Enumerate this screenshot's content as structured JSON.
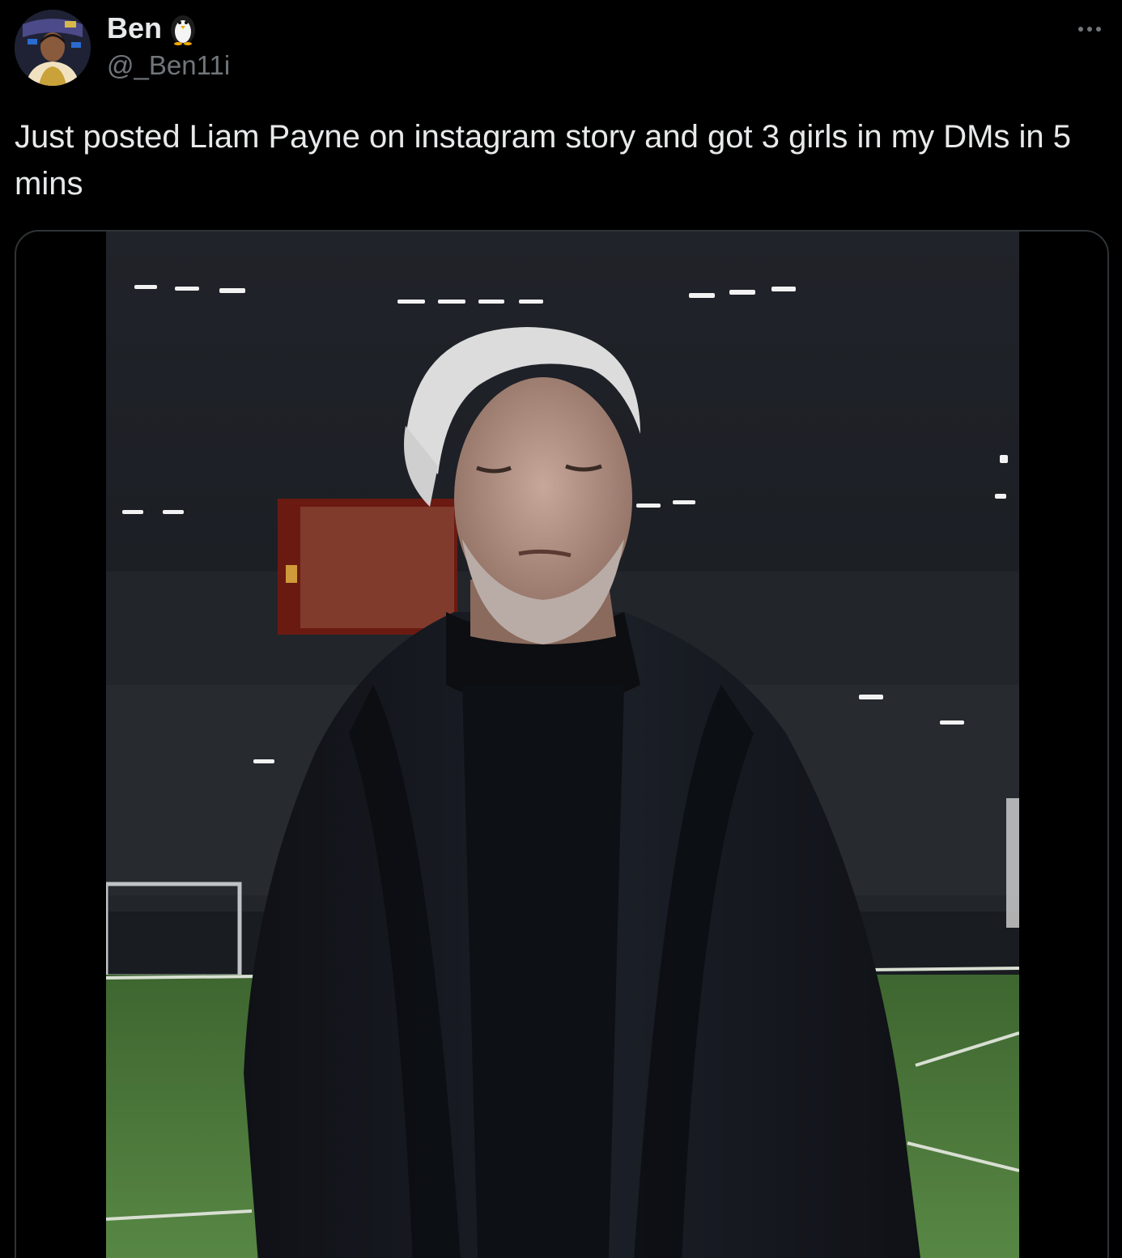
{
  "tweet": {
    "author": {
      "display_name": "Ben",
      "handle": "@_Ben11i",
      "emoji_icon": "penguin-icon",
      "avatar_icon": "avatar-portrait"
    },
    "text": "Just posted Liam Payne on instagram story and got 3 girls in my DMs in 5 mins",
    "more_icon": "more-horizontal-icon",
    "media": {
      "type": "video-still",
      "icon": "stadium-man-in-black-coat"
    }
  },
  "colors": {
    "background": "#000000",
    "text_primary": "#e7e9ea",
    "text_secondary": "#71767b",
    "border": "#2f3336",
    "pitch_green": "#4e7a3a"
  }
}
